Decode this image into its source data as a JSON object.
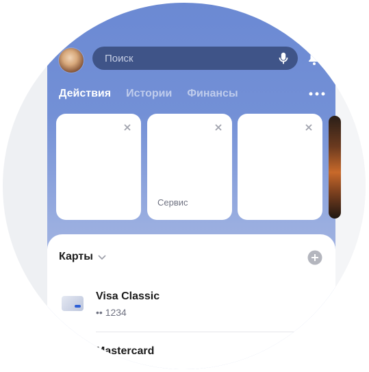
{
  "search": {
    "placeholder": "Поиск"
  },
  "tabs": [
    {
      "label": "Действия",
      "active": true
    },
    {
      "label": "Истории",
      "active": false
    },
    {
      "label": "Финансы",
      "active": false
    }
  ],
  "cards": [
    {
      "label": ""
    },
    {
      "label": "Сервис"
    },
    {
      "label": ""
    }
  ],
  "sheet": {
    "title": "Карты",
    "accounts": [
      {
        "title": "Visa Classic",
        "subtitle": "•• 1234"
      },
      {
        "title": "Mastercard"
      }
    ]
  },
  "icons": [
    "mic-icon",
    "bell-icon",
    "more-icon",
    "close-icon",
    "chevron-down-icon",
    "plus-icon",
    "card-icon"
  ],
  "colors": {
    "header": "#6b89d3",
    "search_bg": "#3f5488",
    "accent": "#2d5fd6"
  }
}
